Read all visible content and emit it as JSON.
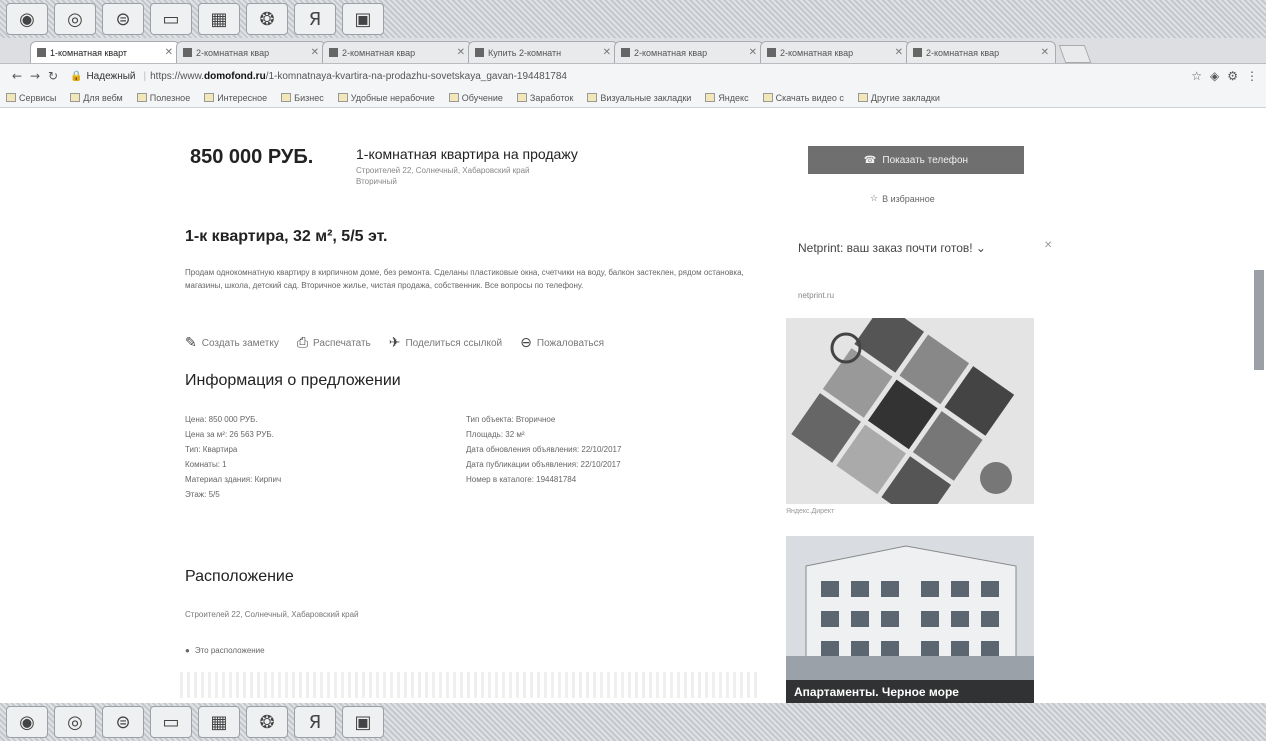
{
  "taskbar": {
    "icons": [
      "chrome-icon",
      "globe-icon",
      "ie-icon",
      "folder-icon",
      "document-icon",
      "media-icon",
      "yandex-icon",
      "archive-icon"
    ],
    "glyphs": [
      "◉",
      "◎",
      "⊜",
      "▭",
      "▦",
      "❂",
      "Я",
      "▣"
    ],
    "clock_time": "",
    "clock_date": ""
  },
  "tabs": [
    {
      "label": "1-комнатная кварт",
      "active": true
    },
    {
      "label": "2-комнатная квар",
      "active": false
    },
    {
      "label": "2-комнатная квар",
      "active": false
    },
    {
      "label": "Купить 2-комнатн",
      "active": false
    },
    {
      "label": "2-комнатная квар",
      "active": false
    },
    {
      "label": "2-комнатная квар",
      "active": false
    },
    {
      "label": "2-комнатная квар",
      "active": false
    }
  ],
  "address": {
    "secure": "Надежный",
    "url_prefix": "https://www.",
    "url_domain": "domofond.ru",
    "url_rest": "/1-komnatnaya-kvartira-na-prodazhu-sovetskaya_gavan-194481784"
  },
  "bookmarks": [
    "Сервисы",
    "Для вебм",
    "Полезное",
    "Интересное",
    "Бизнес",
    "Удобные нерабочие",
    "Обучение",
    "Заработок",
    "Визуальные закладки",
    "Яндекс",
    "Скачать видео с",
    "Другие закладки"
  ],
  "listing": {
    "price": "850 000 РУБ.",
    "title": "1-комнатная квартира на продажу",
    "subtitle": "Строителей 22, Солнечный, Хабаровский край",
    "subtitle2": "Вторичный",
    "headline": "1-к квартира, 32 м², 5/5 эт.",
    "description": "Продам однокомнатную квартиру в кирпичном доме, без ремонта. Сделаны пластиковые окна, счетчики на воду, балкон застеклен, рядом остановка, магазины, школа, детский сад. Вторичное жилье, чистая продажа, собственник. Все вопросы по телефону.",
    "actions": [
      {
        "icon": "pencil-icon",
        "glyph": "✎",
        "label": "Создать заметку"
      },
      {
        "icon": "print-icon",
        "glyph": "⎙",
        "label": "Распечатать"
      },
      {
        "icon": "share-icon",
        "glyph": "✈",
        "label": "Поделиться ссылкой"
      },
      {
        "icon": "complaint-icon",
        "glyph": "⊖",
        "label": "Пожаловаться"
      }
    ]
  },
  "info": {
    "heading": "Информация о предложении",
    "left": [
      "Цена: 850 000 РУБ.",
      "Цена за м²: 26 563 РУБ.",
      "Тип: Квартира",
      "Комнаты: 1",
      "Материал здания: Кирпич",
      "Этаж: 5/5"
    ],
    "right": [
      "Тип объекта: Вторичное",
      "Площадь: 32 м²",
      "Дата обновления объявления: 22/10/2017",
      "Дата публикации объявления: 22/10/2017",
      "Номер в каталоге: 194481784"
    ]
  },
  "location": {
    "heading": "Расположение",
    "address": "Строителей 22, Солнечный, Хабаровский край",
    "map_link": "Это расположение"
  },
  "sidebar": {
    "contact_button": "Показать телефон",
    "favorite_link": "В избранное",
    "ad_title": "Netprint: ваш заказ почти готов! ",
    "ad_domain": "netprint.ru",
    "ad_source": "Яндекс.Директ",
    "ad2_caption": "Апартаменты. Черное море"
  }
}
